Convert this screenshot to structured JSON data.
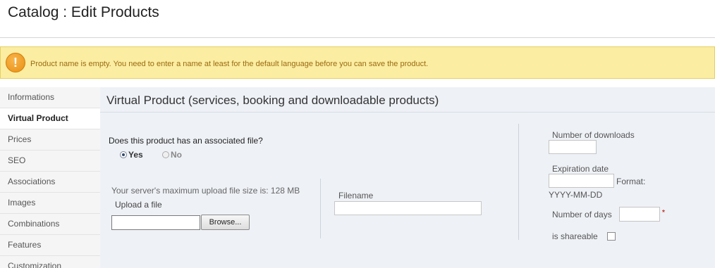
{
  "header": {
    "title": "Catalog : Edit Products"
  },
  "alert": {
    "icon": "warning-icon",
    "icon_glyph": "!",
    "message": "Product name is empty. You need to enter a name at least for the default language before you can save the product."
  },
  "sidebar": {
    "items": [
      {
        "label": "Informations",
        "active": false
      },
      {
        "label": "Virtual Product",
        "active": true
      },
      {
        "label": "Prices",
        "active": false
      },
      {
        "label": "SEO",
        "active": false
      },
      {
        "label": "Associations",
        "active": false
      },
      {
        "label": "Images",
        "active": false
      },
      {
        "label": "Combinations",
        "active": false
      },
      {
        "label": "Features",
        "active": false
      },
      {
        "label": "Customization",
        "active": false
      }
    ]
  },
  "panel": {
    "title": "Virtual Product (services, booking and downloadable products)",
    "question": "Does this product has an associated file?",
    "radio_yes": "Yes",
    "radio_no": "No",
    "selected": "Yes",
    "upload_info": "Your server's maximum upload file size is: 128 MB",
    "upload_label": "Upload a file",
    "browse_label": "Browse...",
    "filename_label": "Filename",
    "filename_value": "",
    "downloads_label": "Number of downloads",
    "downloads_value": "",
    "expiration_label": "Expiration date",
    "expiration_value": "",
    "format_label": "Format:",
    "format_value": "YYYY-MM-DD",
    "days_label": "Number of days",
    "days_value": "",
    "required_mark": "*",
    "shareable_label": "is shareable",
    "shareable_checked": false
  }
}
